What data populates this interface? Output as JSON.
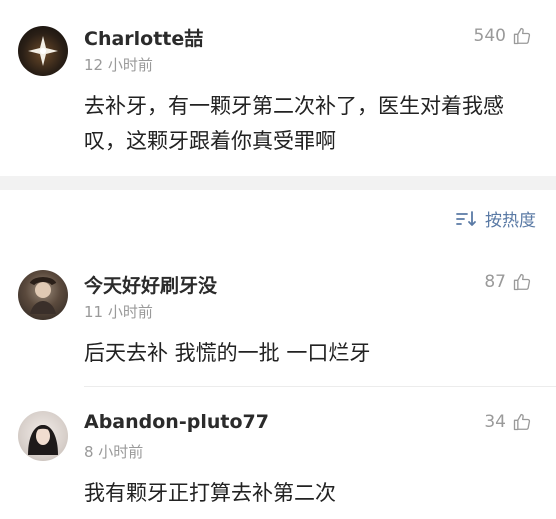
{
  "comments": [
    {
      "username": "Charlotte喆",
      "time": "12 小时前",
      "likes": "540",
      "text": "去补牙，有一颗牙第二次补了，医生对着我感叹，这颗牙跟着你真受罪啊",
      "avatar": "star-avatar"
    },
    {
      "username": "今天好好刷牙没",
      "time": "11 小时前",
      "likes": "87",
      "text": "后天去补 我慌的一批 一口烂牙",
      "avatar": "person-avatar"
    },
    {
      "username": "Abandon-pluto77",
      "time": "8 小时前",
      "likes": "34",
      "text": "我有颗牙正打算去补第二次",
      "avatar": "girl-avatar"
    }
  ],
  "sort": {
    "label": "按热度",
    "icon": "sort-icon"
  },
  "colors": {
    "accent": "#5a7aa5",
    "muted": "#9a9a9a",
    "band": "#f2f2f2"
  }
}
